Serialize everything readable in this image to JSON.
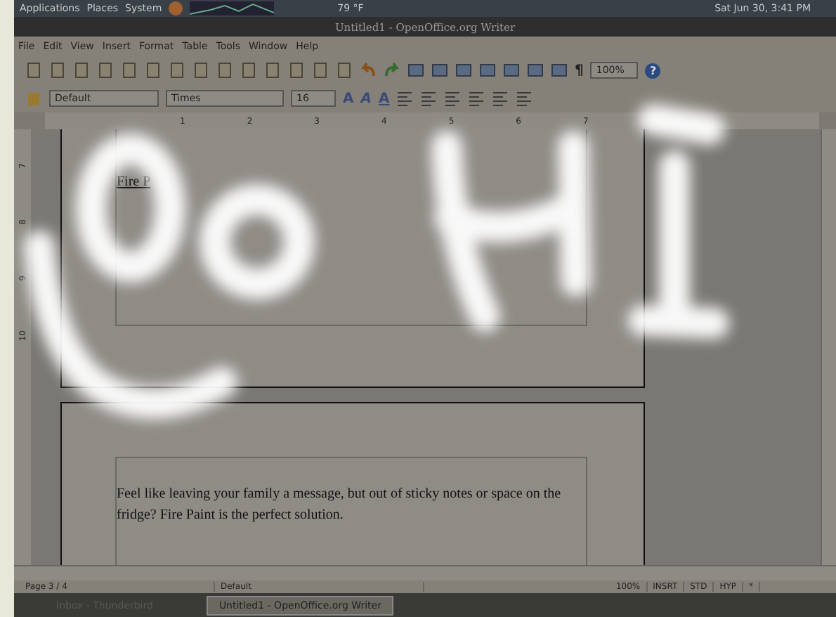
{
  "top_panel": {
    "menus": [
      "Applications",
      "Places",
      "System"
    ],
    "weather": "79 °F",
    "clock": "Sat Jun 30,  3:41 PM"
  },
  "window": {
    "title": "Untitled1 - OpenOffice.org Writer"
  },
  "menu_bar": [
    "File",
    "Edit",
    "View",
    "Insert",
    "Format",
    "Table",
    "Tools",
    "Window",
    "Help"
  ],
  "standard_toolbar": {
    "pilcrow": "¶",
    "zoom": "100%",
    "help": "?"
  },
  "format_toolbar": {
    "style": "Default",
    "font": "Times",
    "size": "16",
    "letters": [
      "A",
      "A",
      "A"
    ]
  },
  "ruler": {
    "horizontal": [
      "1",
      "2",
      "3",
      "4",
      "5",
      "6",
      "7"
    ],
    "vertical": [
      "7",
      "8",
      "9",
      "10"
    ]
  },
  "document": {
    "pages": [
      {
        "text": "Fire P"
      },
      {
        "text": "Feel like leaving your family a message, but out of sticky notes or space on the fridge? Fire Paint is the perfect solution."
      }
    ]
  },
  "status_bar": [
    "Page 3 / 4",
    "Default",
    "100%",
    "INSRT",
    "STD",
    "HYP",
    "*"
  ],
  "taskbar": [
    {
      "label": "Inbox - Thunderbird",
      "selected": false
    },
    {
      "label": "Untitled1 - OpenOffice.org Writer",
      "selected": true
    }
  ]
}
